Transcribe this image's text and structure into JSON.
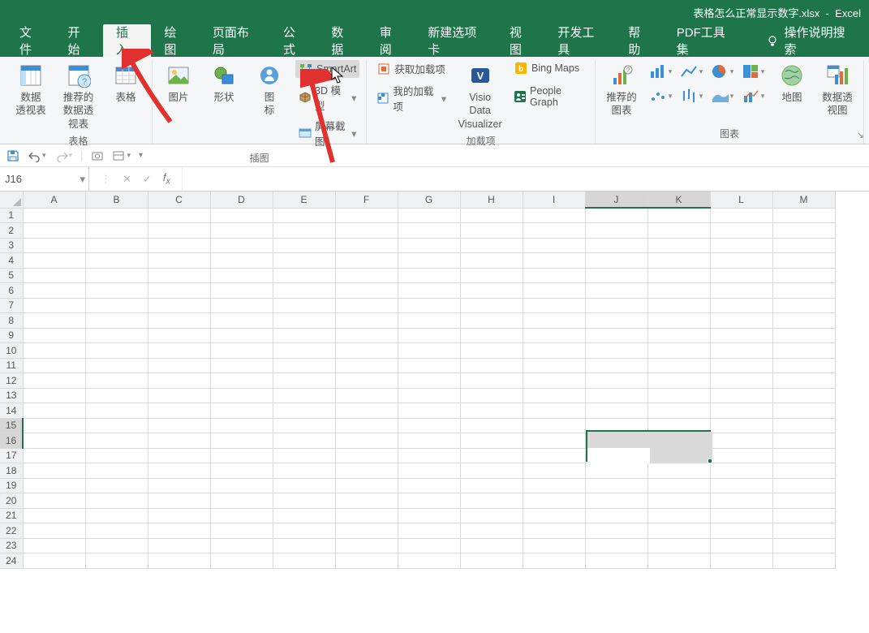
{
  "title": {
    "doc_name": "表格怎么正常显示数字.xlsx",
    "app": "Excel"
  },
  "tabs": {
    "items": [
      "文件",
      "开始",
      "插入",
      "绘图",
      "页面布局",
      "公式",
      "数据",
      "审阅",
      "新建选项卡",
      "视图",
      "开发工具",
      "帮助",
      "PDF工具集"
    ],
    "active_index": 2,
    "tell_me": "操作说明搜索"
  },
  "ribbon": {
    "groups": {
      "tables": {
        "label": "表格",
        "pivot": "数据\n透视表",
        "rec_pivot": "推荐的\n数据透视表",
        "table": "表格"
      },
      "illustrations": {
        "label": "插图",
        "pictures": "图片",
        "shapes": "形状",
        "icons": "图\n标",
        "smartart": "SmartArt",
        "model3d": "3D 模型",
        "screenshot": "屏幕截图"
      },
      "addins": {
        "label": "加载项",
        "get": "获取加载项",
        "my": "我的加载项",
        "visio": "Visio Data\nVisualizer",
        "bing": "Bing Maps",
        "people": "People Graph"
      },
      "charts": {
        "label": "图表",
        "recommended": "推荐的\n图表",
        "map": "地图",
        "pivotchart": "数据透视图"
      }
    }
  },
  "qat": {
    "items": [
      "save",
      "undo",
      "redo",
      "sep",
      "print-preview",
      "mode",
      "more"
    ]
  },
  "formula_bar": {
    "name_box": "J16",
    "fx_value": ""
  },
  "grid": {
    "columns": [
      "A",
      "B",
      "C",
      "D",
      "E",
      "F",
      "G",
      "H",
      "I",
      "J",
      "K",
      "L",
      "M"
    ],
    "rows": 24,
    "selected_columns": [
      "J",
      "K"
    ],
    "selected_rows": [
      15,
      16
    ],
    "active_cell": "J16"
  }
}
